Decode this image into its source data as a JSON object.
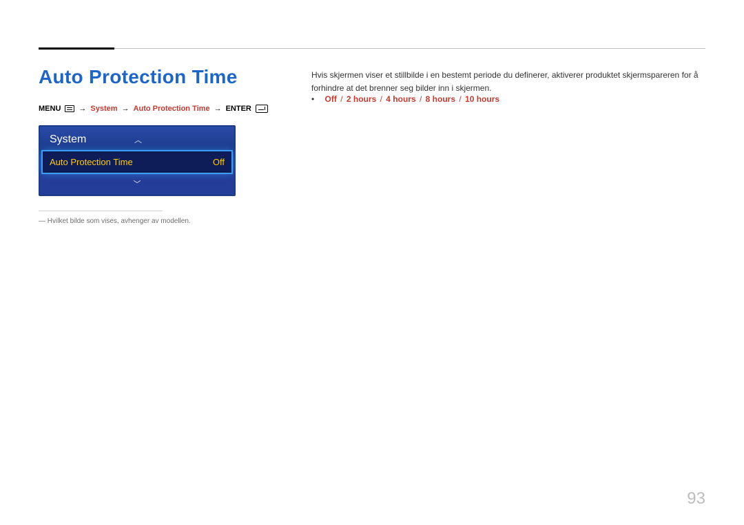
{
  "title": "Auto Protection Time",
  "breadcrumb": {
    "menu_label": "MENU",
    "system": "System",
    "apt": "Auto Protection Time",
    "enter_label": "ENTER"
  },
  "osd": {
    "header": "System",
    "row_label": "Auto Protection Time",
    "row_value": "Off"
  },
  "note": "Hvilket bilde som vises, avhenger av modellen.",
  "description": "Hvis skjermen viser et stillbilde i en bestemt periode du definerer, aktiverer produktet skjermspareren for å forhindre at det brenner seg bilder inn i skjermen.",
  "options": [
    "Off",
    "2 hours",
    "4 hours",
    "8 hours",
    "10 hours"
  ],
  "page_number": "93"
}
